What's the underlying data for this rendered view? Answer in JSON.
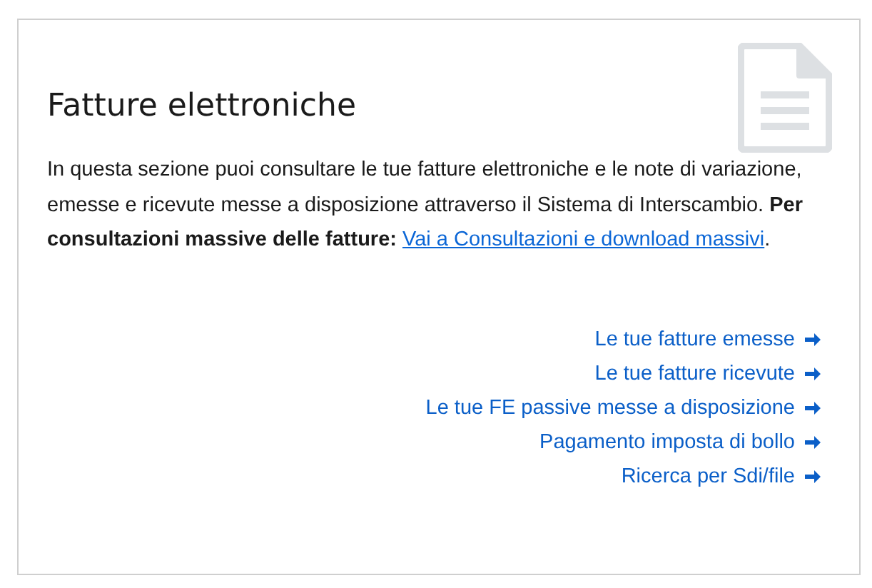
{
  "card": {
    "title": "Fatture elettroniche",
    "description": {
      "text": "In questa sezione puoi consultare le tue fatture elettroniche e le note di variazione, emesse e ricevute messe a disposizione attraverso il Sistema di Interscambio. **Per consultazioni massive delle fatture:**",
      "link": "Vai a Consultazioni e download massivi",
      "trailing": "."
    },
    "links": [
      {
        "label": "Le tue fatture emesse"
      },
      {
        "label": "Le tue fatture ricevute"
      },
      {
        "label": "Le tue FE passive messe a disposizione"
      },
      {
        "label": "Pagamento imposta di bollo"
      },
      {
        "label": "Ricerca per Sdi/file"
      }
    ]
  }
}
